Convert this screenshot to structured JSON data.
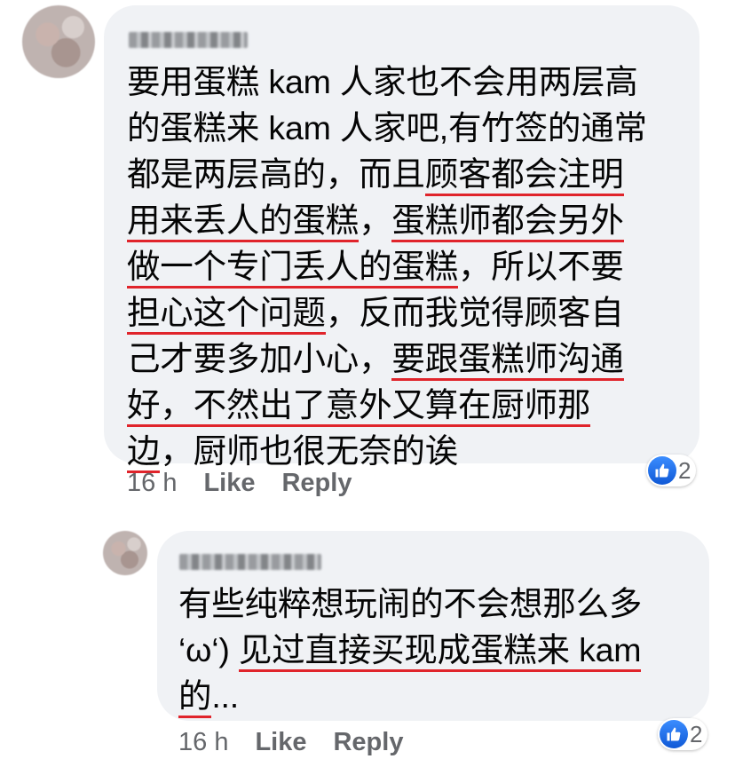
{
  "comments": [
    {
      "text_lines": [
        [
          {
            "t": "要用蛋糕 kam 人家也不会用两层高",
            "u": false
          }
        ],
        [
          {
            "t": "的蛋糕来 kam 人家吧,有竹签的通常",
            "u": false
          }
        ],
        [
          {
            "t": "都是两层高的，而且",
            "u": false
          },
          {
            "t": "顾客都会注明",
            "u": true
          }
        ],
        [
          {
            "t": "用来丢人的蛋糕",
            "u": true
          },
          {
            "t": "，",
            "u": false
          },
          {
            "t": "蛋糕师都会另外",
            "u": true
          }
        ],
        [
          {
            "t": "做一个专门丢人的蛋糕",
            "u": true
          },
          {
            "t": "，所以不要",
            "u": false
          }
        ],
        [
          {
            "t": "担心这个问题",
            "u": true
          },
          {
            "t": "，反而我觉得顾客自",
            "u": false
          }
        ],
        [
          {
            "t": "己才要多加小心，",
            "u": false
          },
          {
            "t": "要跟蛋糕师沟通",
            "u": true
          }
        ],
        [
          {
            "t": "好，不然出了意外又算在厨师那",
            "u": true
          }
        ],
        [
          {
            "t": "边",
            "u": true
          },
          {
            "t": "，厨师也很无奈的诶",
            "u": false
          }
        ]
      ],
      "meta": {
        "time": "16 h",
        "like": "Like",
        "reply": "Reply"
      },
      "reaction_count": "2"
    },
    {
      "text_lines": [
        [
          {
            "t": "有些纯粹想玩闹的不会想那么多",
            "u": false
          }
        ],
        [
          {
            "t": "‘ω‘) ",
            "u": false
          },
          {
            "t": "见过直接买现成蛋糕来 kam",
            "u": true
          }
        ],
        [
          {
            "t": "的",
            "u": true
          },
          {
            "t": "...",
            "u": false
          }
        ]
      ],
      "meta": {
        "time": "16 h",
        "like": "Like",
        "reply": "Reply"
      },
      "reaction_count": "2"
    }
  ],
  "icons": {
    "reaction": "like-thumb-icon"
  },
  "colors": {
    "underline": "#e0242b",
    "bubble": "#f0f2f5",
    "like_blue": "#1877f2"
  }
}
